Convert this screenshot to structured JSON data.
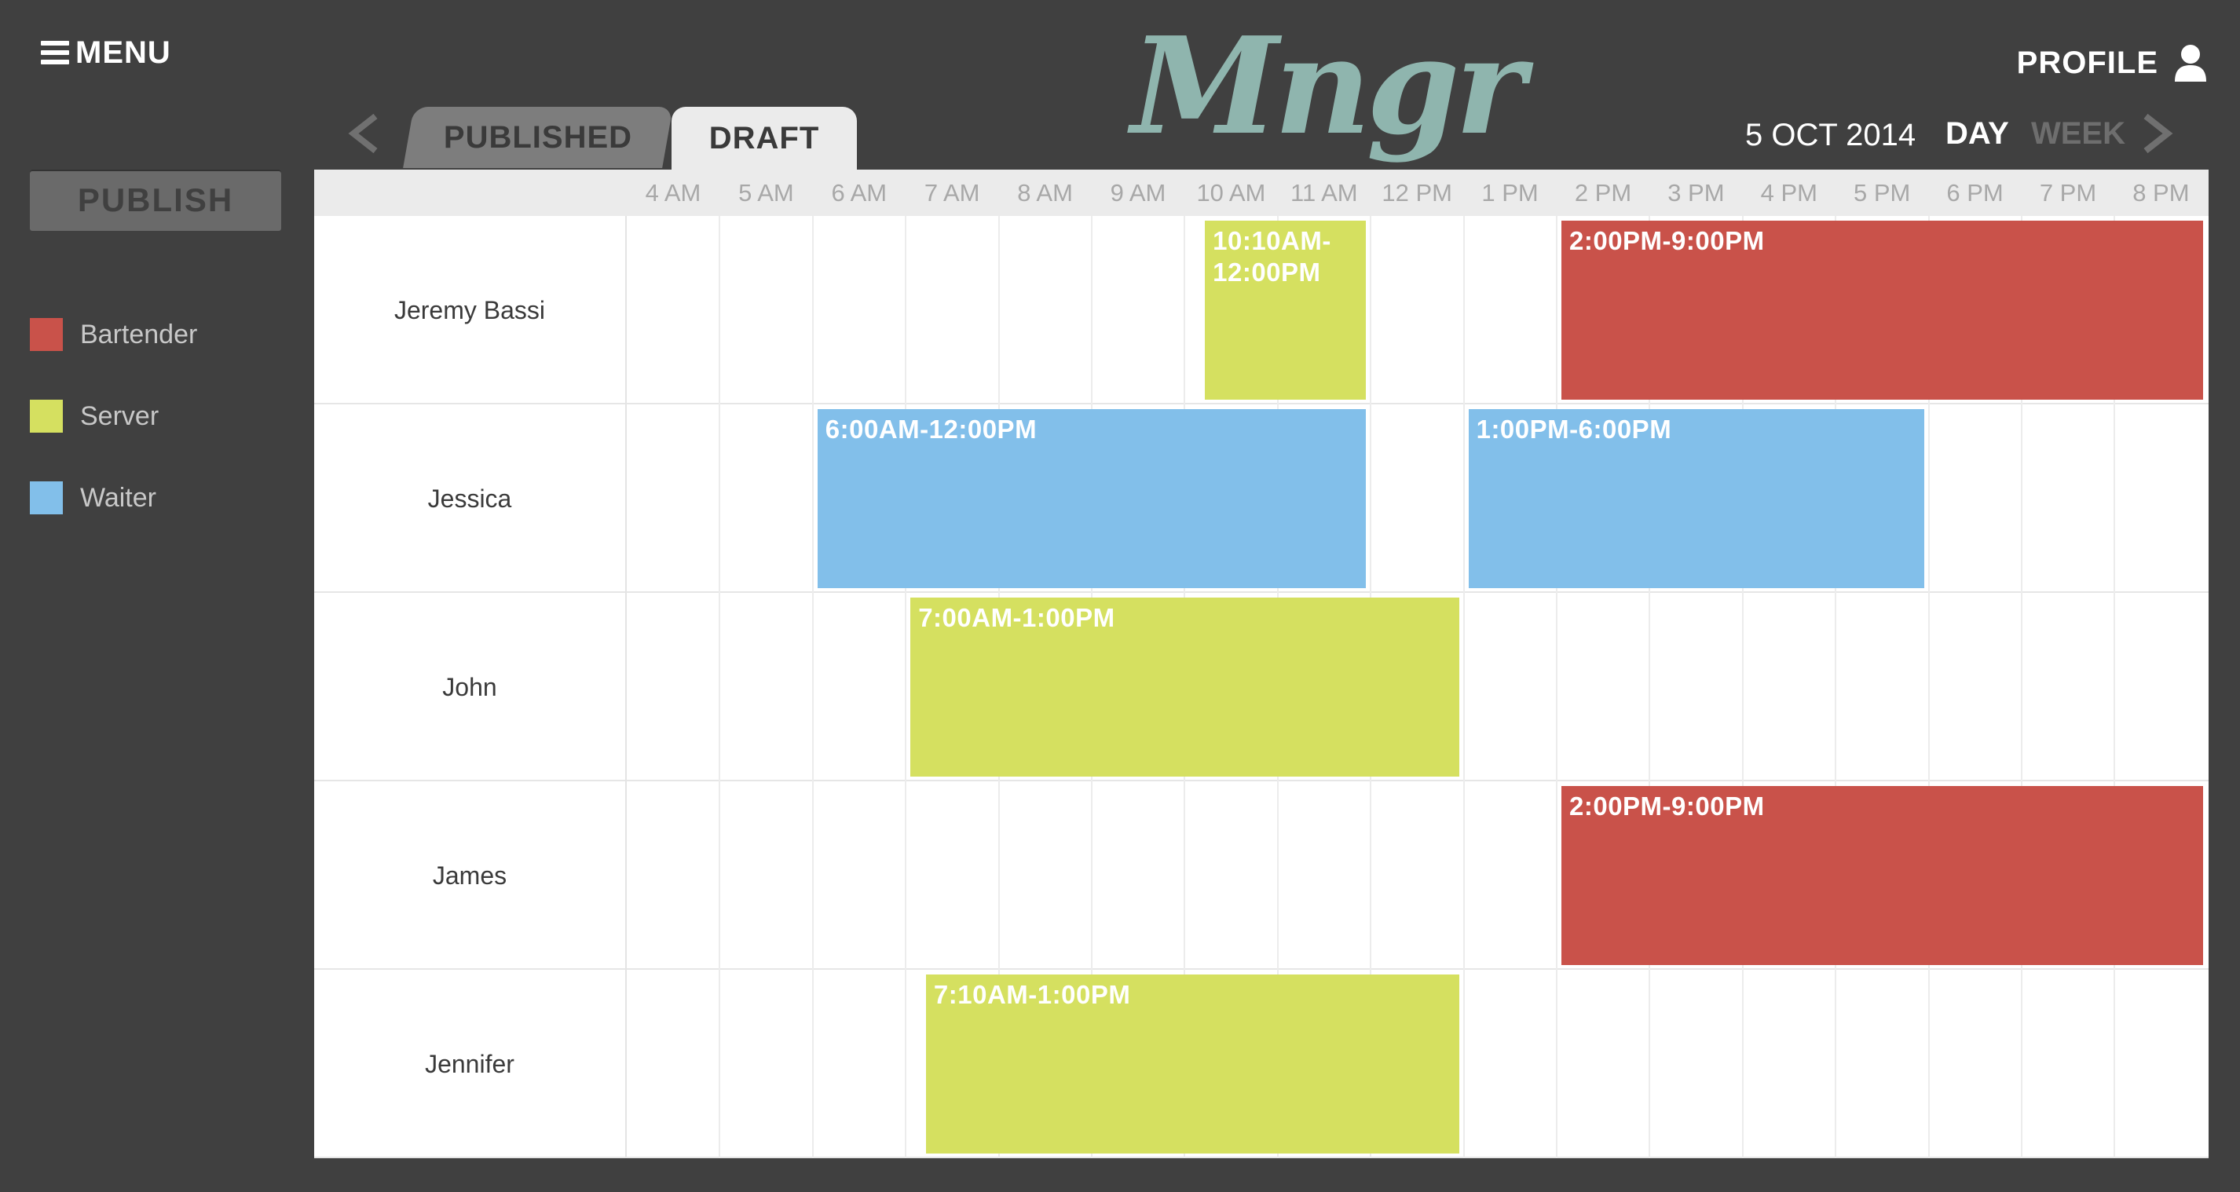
{
  "app": {
    "logo_text": "Mngr",
    "menu_label": "MENU",
    "profile_label": "PROFILE"
  },
  "sidebar": {
    "publish_label": "PUBLISH",
    "legend": [
      {
        "label": "Bartender",
        "color": "#c9524a"
      },
      {
        "label": "Server",
        "color": "#d5e060"
      },
      {
        "label": "Waiter",
        "color": "#82bfea"
      }
    ]
  },
  "tabs": {
    "published": "PUBLISHED",
    "draft": "DRAFT",
    "active": "DRAFT"
  },
  "toolbar": {
    "date": "5 OCT 2014",
    "view_day": "DAY",
    "view_week": "WEEK",
    "active_view": "DAY"
  },
  "schedule": {
    "hours": [
      "4 AM",
      "5 AM",
      "6 AM",
      "7 AM",
      "8 AM",
      "9 AM",
      "10 AM",
      "11 AM",
      "12 PM",
      "1 PM",
      "2 PM",
      "3 PM",
      "4 PM",
      "5 PM",
      "6 PM",
      "7 PM",
      "8 PM"
    ],
    "employees": [
      {
        "name": "Jeremy Bassi",
        "shifts": [
          {
            "label": "10:10AM-12:00PM",
            "role": "Server",
            "start": 10.1667,
            "end": 12
          },
          {
            "label": "2:00PM-9:00PM",
            "role": "Bartender",
            "start": 14,
            "end": 21
          }
        ]
      },
      {
        "name": "Jessica",
        "shifts": [
          {
            "label": "6:00AM-12:00PM",
            "role": "Waiter",
            "start": 6,
            "end": 12
          },
          {
            "label": "1:00PM-6:00PM",
            "role": "Waiter",
            "start": 13,
            "end": 18
          }
        ]
      },
      {
        "name": "John",
        "shifts": [
          {
            "label": "7:00AM-1:00PM",
            "role": "Server",
            "start": 7,
            "end": 13
          }
        ]
      },
      {
        "name": "James",
        "shifts": [
          {
            "label": "2:00PM-9:00PM",
            "role": "Bartender",
            "start": 14,
            "end": 21
          }
        ]
      },
      {
        "name": "Jennifer",
        "shifts": [
          {
            "label": "7:10AM-1:00PM",
            "role": "Server",
            "start": 7.1667,
            "end": 13
          }
        ]
      }
    ]
  }
}
